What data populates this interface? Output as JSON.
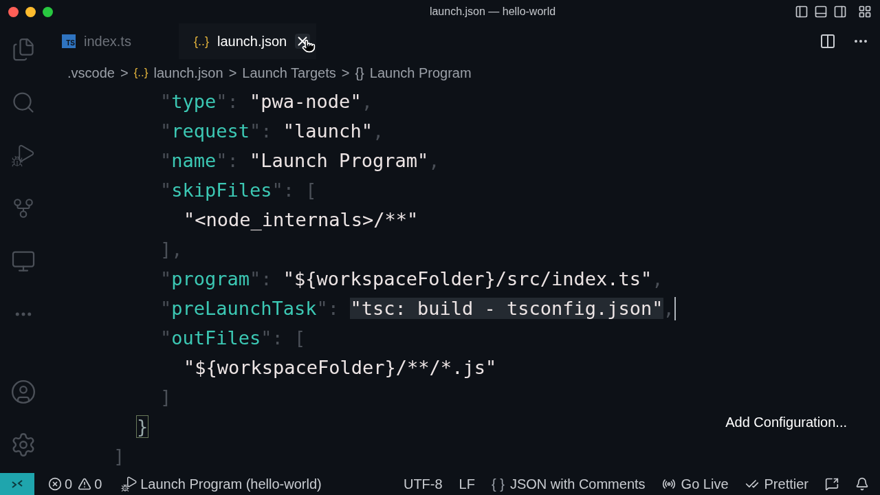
{
  "window": {
    "title": "launch.json — hello-world"
  },
  "tabs": [
    {
      "label": "index.ts",
      "icon": "TS",
      "kind": "ts",
      "selected": false
    },
    {
      "label": "launch.json",
      "icon": "{..}",
      "kind": "json",
      "selected": true
    }
  ],
  "breadcrumbs": [
    {
      "label": ".vscode",
      "kind": "folder"
    },
    {
      "label": "launch.json",
      "icon": "{..}",
      "kind": "file"
    },
    {
      "label": "Launch Targets",
      "kind": "plain"
    },
    {
      "label": "Launch Program",
      "icon": "{}",
      "kind": "symbol"
    }
  ],
  "breadcrumb_separator": ">",
  "code": {
    "lines": [
      {
        "children": [
          {
            "children": [
              {
                "tokens": [
                  {
                    "kind": "punct",
                    "text": "\""
                  },
                  {
                    "kind": "key",
                    "text": "type"
                  },
                  {
                    "kind": "punct",
                    "text": "\": "
                  },
                  {
                    "kind": "string",
                    "text": "\"pwa-node\""
                  },
                  {
                    "kind": "punct",
                    "text": ","
                  }
                ]
              },
              {
                "tokens": [
                  {
                    "kind": "punct",
                    "text": "\""
                  },
                  {
                    "kind": "key",
                    "text": "request"
                  },
                  {
                    "kind": "punct",
                    "text": "\": "
                  },
                  {
                    "kind": "string",
                    "text": "\"launch\""
                  },
                  {
                    "kind": "punct",
                    "text": ","
                  }
                ]
              },
              {
                "tokens": [
                  {
                    "kind": "punct",
                    "text": "\""
                  },
                  {
                    "kind": "key",
                    "text": "name"
                  },
                  {
                    "kind": "punct",
                    "text": "\": "
                  },
                  {
                    "kind": "string",
                    "text": "\"Launch Program\""
                  },
                  {
                    "kind": "punct",
                    "text": ","
                  }
                ]
              },
              {
                "tokens": [
                  {
                    "kind": "punct",
                    "text": "\""
                  },
                  {
                    "kind": "key",
                    "text": "skipFiles"
                  },
                  {
                    "kind": "punct",
                    "text": "\": ["
                  }
                ],
                "children": [
                  {
                    "tokens": [
                      {
                        "kind": "string",
                        "text": "\"<node_internals>/**\""
                      }
                    ]
                  }
                ]
              },
              {
                "tokens": [
                  {
                    "kind": "punct",
                    "text": "],"
                  }
                ]
              },
              {
                "tokens": [
                  {
                    "kind": "punct",
                    "text": "\""
                  },
                  {
                    "kind": "key",
                    "text": "program"
                  },
                  {
                    "kind": "punct",
                    "text": "\": "
                  },
                  {
                    "kind": "string",
                    "text": "\"${workspaceFolder}/src/index.ts\""
                  },
                  {
                    "kind": "punct",
                    "text": ","
                  }
                ]
              },
              {
                "tokens": [
                  {
                    "kind": "punct",
                    "text": "\""
                  },
                  {
                    "kind": "key",
                    "text": "preLaunchTask"
                  },
                  {
                    "kind": "punct",
                    "text": "\": "
                  },
                  {
                    "kind": "string",
                    "text": "\"tsc: build - tsconfig.json\"",
                    "highlighted": true
                  },
                  {
                    "kind": "punct",
                    "text": ","
                  }
                ],
                "cursor": true
              },
              {
                "tokens": [
                  {
                    "kind": "punct",
                    "text": "\""
                  },
                  {
                    "kind": "key",
                    "text": "outFiles"
                  },
                  {
                    "kind": "punct",
                    "text": "\": ["
                  }
                ],
                "children": [
                  {
                    "tokens": [
                      {
                        "kind": "string",
                        "text": "\"${workspaceFolder}/**/*.js\""
                      }
                    ]
                  }
                ]
              },
              {
                "tokens": [
                  {
                    "kind": "punct",
                    "text": "]"
                  }
                ]
              }
            ]
          },
          {
            "tokens": [
              {
                "kind": "bracket",
                "text": "}",
                "matched": true
              }
            ]
          }
        ]
      },
      {
        "tokens": [
          {
            "kind": "punct",
            "text": "]"
          }
        ]
      }
    ]
  },
  "add_configuration": "Add Configuration...",
  "status_bar": {
    "errors": "0",
    "warnings": "0",
    "debug": "Launch Program (hello-world)",
    "items": [
      {
        "kind": "text",
        "label": "UTF-8"
      },
      {
        "kind": "text",
        "label": "LF"
      },
      {
        "kind": "language",
        "label": "JSON with Comments",
        "icon": "{ }"
      },
      {
        "kind": "live",
        "label": "Go Live"
      },
      {
        "kind": "prettier",
        "label": "Prettier"
      },
      {
        "kind": "feedback"
      },
      {
        "kind": "bell"
      }
    ]
  }
}
